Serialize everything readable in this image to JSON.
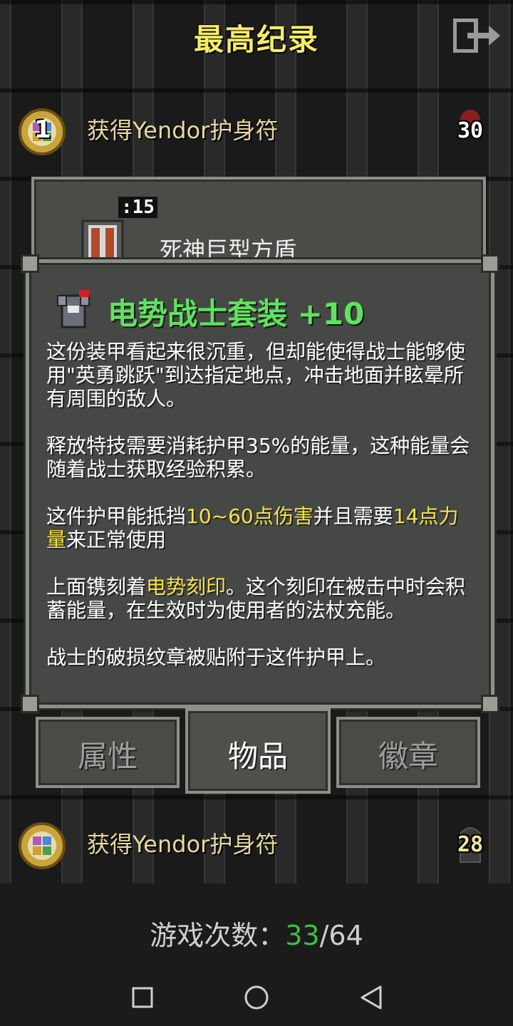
{
  "screen": {
    "title": "最高纪录",
    "exit_icon": "exit-door-icon"
  },
  "records": [
    {
      "rank": "1",
      "text": "获得Yendor护身符",
      "depth": "30",
      "rank_icon": "amulet-rank-icon",
      "depth_icon": "skull-depth-icon"
    },
    {
      "rank": "",
      "text": "获得Yendor护身符",
      "depth": "28",
      "rank_icon": "amulet-rank-icon",
      "depth_icon": "tombstone-depth-icon"
    }
  ],
  "item_panel": {
    "quantity": ":15",
    "item_name": "死神巨型方盾",
    "item_icon": "shield-icon"
  },
  "detail": {
    "armor_icon": "armor-icon",
    "title": "电势战士套装 +10",
    "para1": "这份装甲看起来很沉重，但却能使得战士能够使用\"英勇跳跃\"到达指定地点，冲击地面并眩晕所有周围的敌人。",
    "para2": "释放特技需要消耗护甲35%的能量，这种能量会随着战士获取经验积累。",
    "para3_a": "这件护甲能抵挡",
    "para3_hl1": "10~60点伤害",
    "para3_b": "并且需要",
    "para3_hl2": "14点力量",
    "para3_c": "来正常使用",
    "para4_a": "上面镌刻着",
    "para4_hl": "电势刻印",
    "para4_b": "。这个刻印在被击中时会积蓄能量，在生效时为使用者的法杖充能。",
    "para5": "战士的破损纹章被贴附于这件护甲上。"
  },
  "tabs": [
    {
      "label": "属性",
      "active": false
    },
    {
      "label": "物品",
      "active": true
    },
    {
      "label": "徽章",
      "active": false
    }
  ],
  "games": {
    "label": "游戏次数：",
    "won": "33",
    "total": "/64"
  },
  "navbar": {
    "recent_icon": "square-recent-icon",
    "home_icon": "circle-home-icon",
    "back_icon": "triangle-back-icon"
  },
  "colors": {
    "title": "#f5ec67",
    "armor_title": "#5fe25f",
    "highlight": "#f2e24a",
    "won_count": "#3fbf3f"
  }
}
